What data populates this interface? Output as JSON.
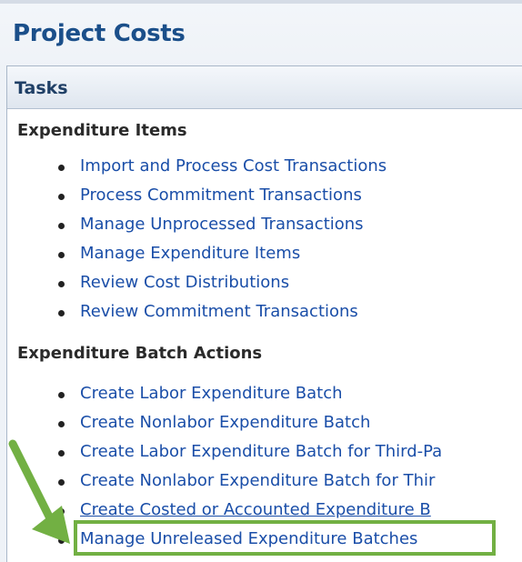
{
  "page": {
    "title": "Project Costs"
  },
  "tasks_panel": {
    "title": "Tasks",
    "sections": [
      {
        "heading": "Expenditure Items",
        "items": [
          "Import and Process Cost Transactions",
          "Process Commitment Transactions",
          "Manage Unprocessed Transactions",
          "Manage Expenditure Items",
          "Review Cost Distributions",
          "Review Commitment Transactions"
        ]
      },
      {
        "heading": "Expenditure Batch Actions",
        "items": [
          "Create Labor Expenditure Batch",
          "Create Nonlabor Expenditure Batch",
          "Create Labor Expenditure Batch for Third-Pa",
          "Create Nonlabor Expenditure Batch for Thir",
          "Create Costed or Accounted Expenditure B",
          "Manage Unreleased Expenditure Batches"
        ]
      }
    ]
  },
  "annotation": {
    "highlight_color": "#72b043",
    "arrow_color": "#72b043",
    "highlighted_item": "Manage Unreleased Expenditure Batches"
  }
}
